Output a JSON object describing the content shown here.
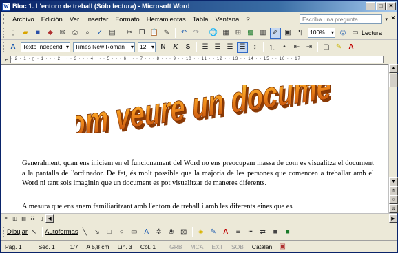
{
  "window": {
    "title": "Bloc 1. L'entorn de treball (Sólo lectura) - Microsoft Word"
  },
  "menubar": {
    "items": [
      "Archivo",
      "Edición",
      "Ver",
      "Insertar",
      "Formato",
      "Herramientas",
      "Tabla",
      "Ventana",
      "?"
    ],
    "ask_placeholder": "Escriba una pregunta"
  },
  "toolbar_standard": {
    "zoom": "100%",
    "reading_label": "Lectura"
  },
  "toolbar_format": {
    "style": "Texto independ",
    "font": "Times New Roman",
    "size": "12",
    "bold": "N",
    "italic": "K",
    "underline": "S"
  },
  "ruler": {
    "scale": "· 2 · 1 · ▯ · 1 · · · 2 · · · 3 · · · 4 · · · 5 · · · 6 · · · 7 · · · 8 · · · 9 · · 10 · · 11 · · 12 · · 13 · · 14 · · 15 · · 16 · · 17"
  },
  "document": {
    "wordart": "Com veure un document",
    "paragraph1": "Generalment, quan ens iniciem en el funcionament del Word no ens preocupem massa de com es visualitza el document a la pantalla de l'ordinador. De fet, és molt possible que la majoria de les persones que comencen a treballar amb el Word ni tant sols imaginin que un document es pot visualitzar de maneres diferents.",
    "paragraph2": "A mesura que ens anem familiaritzant amb l'entorn de treball i amb les diferents eines que es"
  },
  "drawbar": {
    "draw_label": "Dibujar",
    "autoshapes_label": "Autoformas"
  },
  "statusbar": {
    "page": "Pág. 1",
    "section": "Sec. 1",
    "pages": "1/7",
    "at": "A 5,8 cm",
    "line": "Lín. 3",
    "col": "Col. 1",
    "grb": "GRB",
    "mca": "MCA",
    "ext": "EXT",
    "sob": "SOB",
    "language": "Catalán"
  },
  "colors": {
    "titlebar": "#0a246a",
    "wordart_fill": "#f08a1c",
    "wordart_shadow": "#8a3a06"
  }
}
